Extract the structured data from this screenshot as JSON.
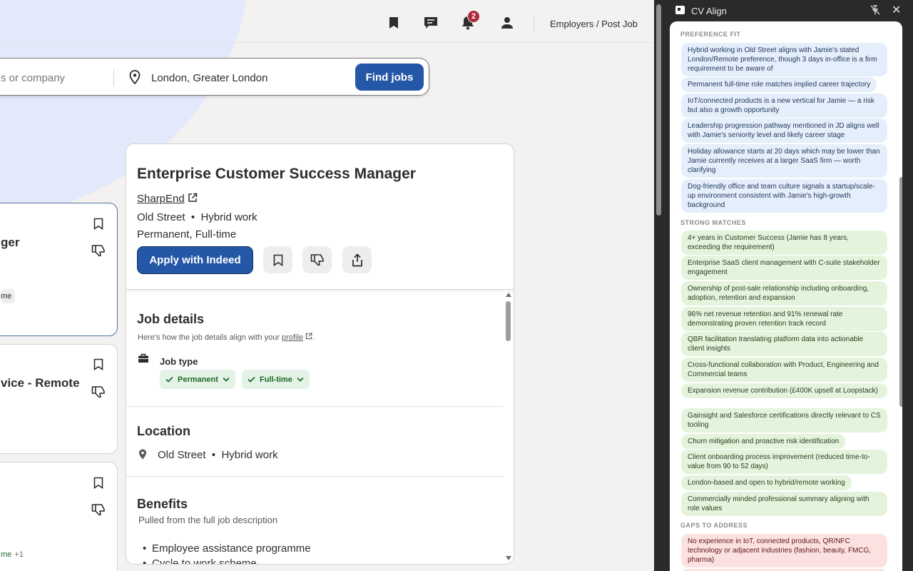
{
  "nav": {
    "links_label": "Employers / Post Job",
    "notification_count": "2"
  },
  "search": {
    "what_placeholder": "s or company",
    "where_value": "London, Greater London",
    "find_label": "Find jobs"
  },
  "job_list": [
    {
      "title": "ger",
      "tag": "me"
    },
    {
      "title": "vice - Remote"
    },
    {
      "tag": "me",
      "tag_extra": "+1"
    }
  ],
  "job": {
    "title": "Enterprise Customer Success Manager",
    "company": "SharpEnd",
    "location": "Old Street",
    "work_mode": "Hybrid work",
    "job_type": "Permanent, Full-time",
    "apply_label": "Apply with Indeed"
  },
  "details": {
    "heading": "Job details",
    "sub_prefix": "Here's how the job details align with your ",
    "sub_link": "profile",
    "sub_suffix": ".",
    "job_type_label": "Job type",
    "job_type_pills": [
      "Permanent",
      "Full-time"
    ],
    "location_heading": "Location",
    "location": "Old Street",
    "work_mode": "Hybrid work",
    "benefits_heading": "Benefits",
    "benefits_sub": "Pulled from the full job description",
    "benefits": [
      "Employee assistance programme",
      "Cycle to work scheme"
    ]
  },
  "cv_align": {
    "title": "CV Align",
    "preference_heading": "PREFERENCE FIT",
    "preference": [
      "Hybrid working in Old Street aligns with Jamie's stated London/Remote preference, though 3 days in-office is a firm requirement to be aware of",
      "Permanent full-time role matches implied career trajectory",
      "IoT/connected products is a new vertical for Jamie — a risk but also a growth opportunity",
      "Leadership progression pathway mentioned in JD aligns well with Jamie's seniority level and likely career stage",
      "Holiday allowance starts at 20 days which may be lower than Jamie currently receives at a larger SaaS firm — worth clarifying",
      "Dog-friendly office and team culture signals a startup/scale-up environment consistent with Jamie's high-growth background"
    ],
    "strong_heading": "STRONG MATCHES",
    "strong": [
      "4+ years in Customer Success (Jamie has 8 years, exceeding the requirement)",
      "Enterprise SaaS client management with C-suite stakeholder engagement",
      "Ownership of post-sale relationship including onboarding, adoption, retention and expansion",
      "96% net revenue retention and 91% renewal rate demonstrating proven retention track record",
      "QBR facilitation translating platform data into actionable client insights",
      "Cross-functional collaboration with Product, Engineering and Commercial teams",
      "Expansion revenue contribution (£400K upsell at Loopstack)",
      "Gainsight and Salesforce certifications directly relevant to CS tooling",
      "Churn mitigation and proactive risk identification",
      "Client onboarding process improvement (reduced time-to-value from 90 to 52 days)",
      "London-based and open to hybrid/remote working",
      "Commercially minded professional summary aligning with role values"
    ],
    "gaps_heading": "GAPS TO ADDRESS",
    "gaps": [
      "No experience in IoT, connected products, QR/NFC technology or adjacent industries (fashion, beauty, FMCG, pharma)"
    ]
  }
}
